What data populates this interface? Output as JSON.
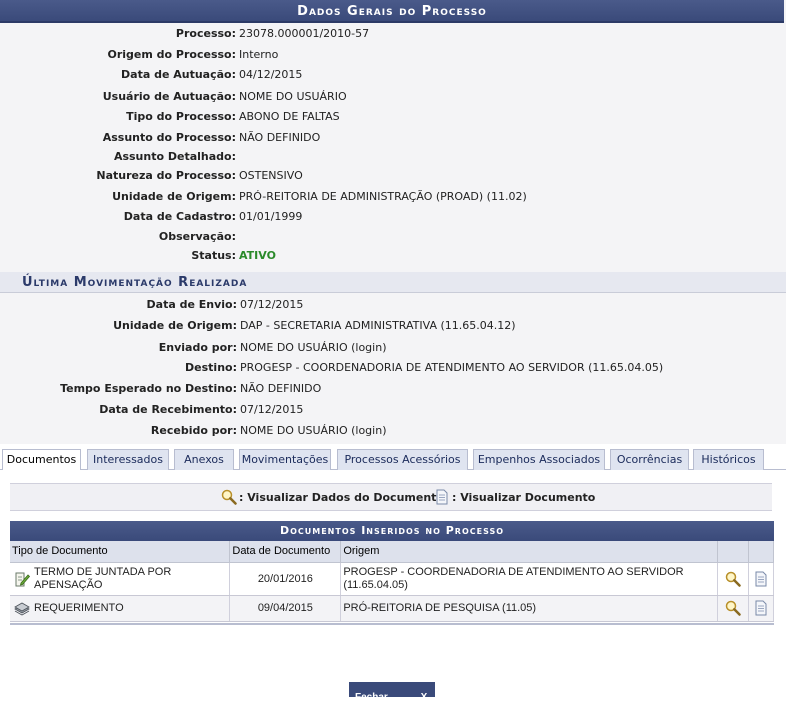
{
  "header": {
    "title": "Dados Gerais do Processo"
  },
  "general": [
    {
      "label": "Processo:",
      "value": "23078.000001/2010-57"
    },
    {
      "label": "Origem do Processo:",
      "value": "Interno"
    },
    {
      "label": "Data de Autuação:",
      "value": "04/12/2015"
    },
    {
      "label": "Usuário de Autuação:",
      "value": "NOME DO USUÁRIO"
    },
    {
      "label": "Tipo do Processo:",
      "value": "ABONO DE FALTAS"
    },
    {
      "label": "Assunto do Processo:",
      "value": "NÃO DEFINIDO"
    },
    {
      "label": "Assunto Detalhado:",
      "value": ""
    },
    {
      "label": "Natureza do Processo:",
      "value": "OSTENSIVO"
    },
    {
      "label": "Unidade de Origem:",
      "value": "PRÓ-REITORIA DE ADMINISTRAÇÃO (PROAD) (11.02)"
    },
    {
      "label": "Data de Cadastro:",
      "value": "01/01/1999"
    },
    {
      "label": "Observação:",
      "value": ""
    },
    {
      "label": "Status:",
      "value": "ATIVO"
    }
  ],
  "last_movement": {
    "title": "Última Movimentação Realizada",
    "rows": [
      {
        "label": "Data de Envio:",
        "value": "07/12/2015"
      },
      {
        "label": "Unidade de Origem:",
        "value": "DAP - SECRETARIA ADMINISTRATIVA (11.65.04.12)"
      },
      {
        "label": "Enviado por:",
        "value": "NOME DO USUÁRIO (login)"
      },
      {
        "label": "Destino:",
        "value": "PROGESP - COORDENADORIA DE ATENDIMENTO AO SERVIDOR (11.65.04.05)"
      },
      {
        "label": "Tempo Esperado no Destino:",
        "value": "NÃO DEFINIDO"
      },
      {
        "label": "Data de Recebimento:",
        "value": "07/12/2015"
      },
      {
        "label": "Recebido por:",
        "value": "NOME DO USUÁRIO (login)"
      }
    ]
  },
  "tabs": [
    {
      "label": "Documentos",
      "active": true
    },
    {
      "label": "Interessados"
    },
    {
      "label": "Anexos"
    },
    {
      "label": "Movimentações"
    },
    {
      "label": "Processos Acessórios"
    },
    {
      "label": "Empenhos Associados"
    },
    {
      "label": "Ocorrências"
    },
    {
      "label": "Históricos"
    }
  ],
  "legend": {
    "view_data": ": Visualizar Dados do Documento",
    "view_doc": ": Visualizar Documento"
  },
  "documents": {
    "title": "Documentos Inseridos no Processo",
    "columns": [
      "Tipo de Documento",
      "Data de Documento",
      "Origem"
    ],
    "rows": [
      {
        "tipo": "TERMO DE JUNTADA POR APENSAÇÃO",
        "data": "20/01/2016",
        "origem": "PROGESP - COORDENADORIA DE ATENDIMENTO AO SERVIDOR (11.65.04.05)",
        "icon": "edit-document-icon"
      },
      {
        "tipo": "REQUERIMENTO",
        "data": "09/04/2015",
        "origem": "PRÓ-REITORIA DE PESQUISA (11.05)",
        "icon": "document-stack-icon"
      }
    ]
  },
  "footer": {
    "close_label": "Fechar",
    "close_x": "X"
  },
  "colors": {
    "header_bg": "#3a4a7a",
    "status_active": "#2a8a2a",
    "tab_bg": "#dfe4f0"
  }
}
